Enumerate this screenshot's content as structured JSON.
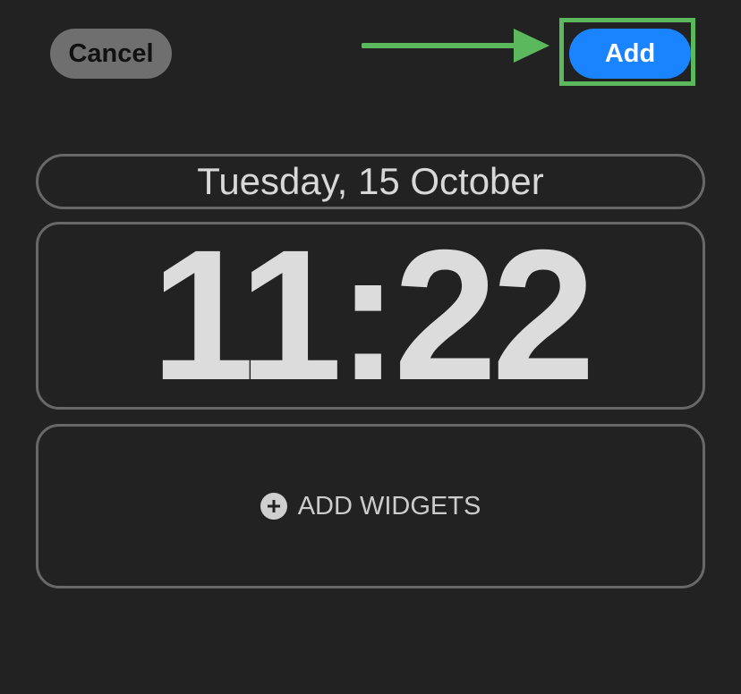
{
  "header": {
    "cancel_label": "Cancel",
    "add_label": "Add"
  },
  "lock_screen": {
    "date": "Tuesday, 15 October",
    "time": "11:22",
    "widgets_label": "ADD WIDGETS"
  },
  "colors": {
    "background": "#222222",
    "add_button": "#1a84ff",
    "cancel_button": "#6f6f6f",
    "annotation_green": "#5cb85c"
  },
  "icons": {
    "annotation_arrow": "arrow-right-icon",
    "widgets": "plus-circle-icon"
  }
}
